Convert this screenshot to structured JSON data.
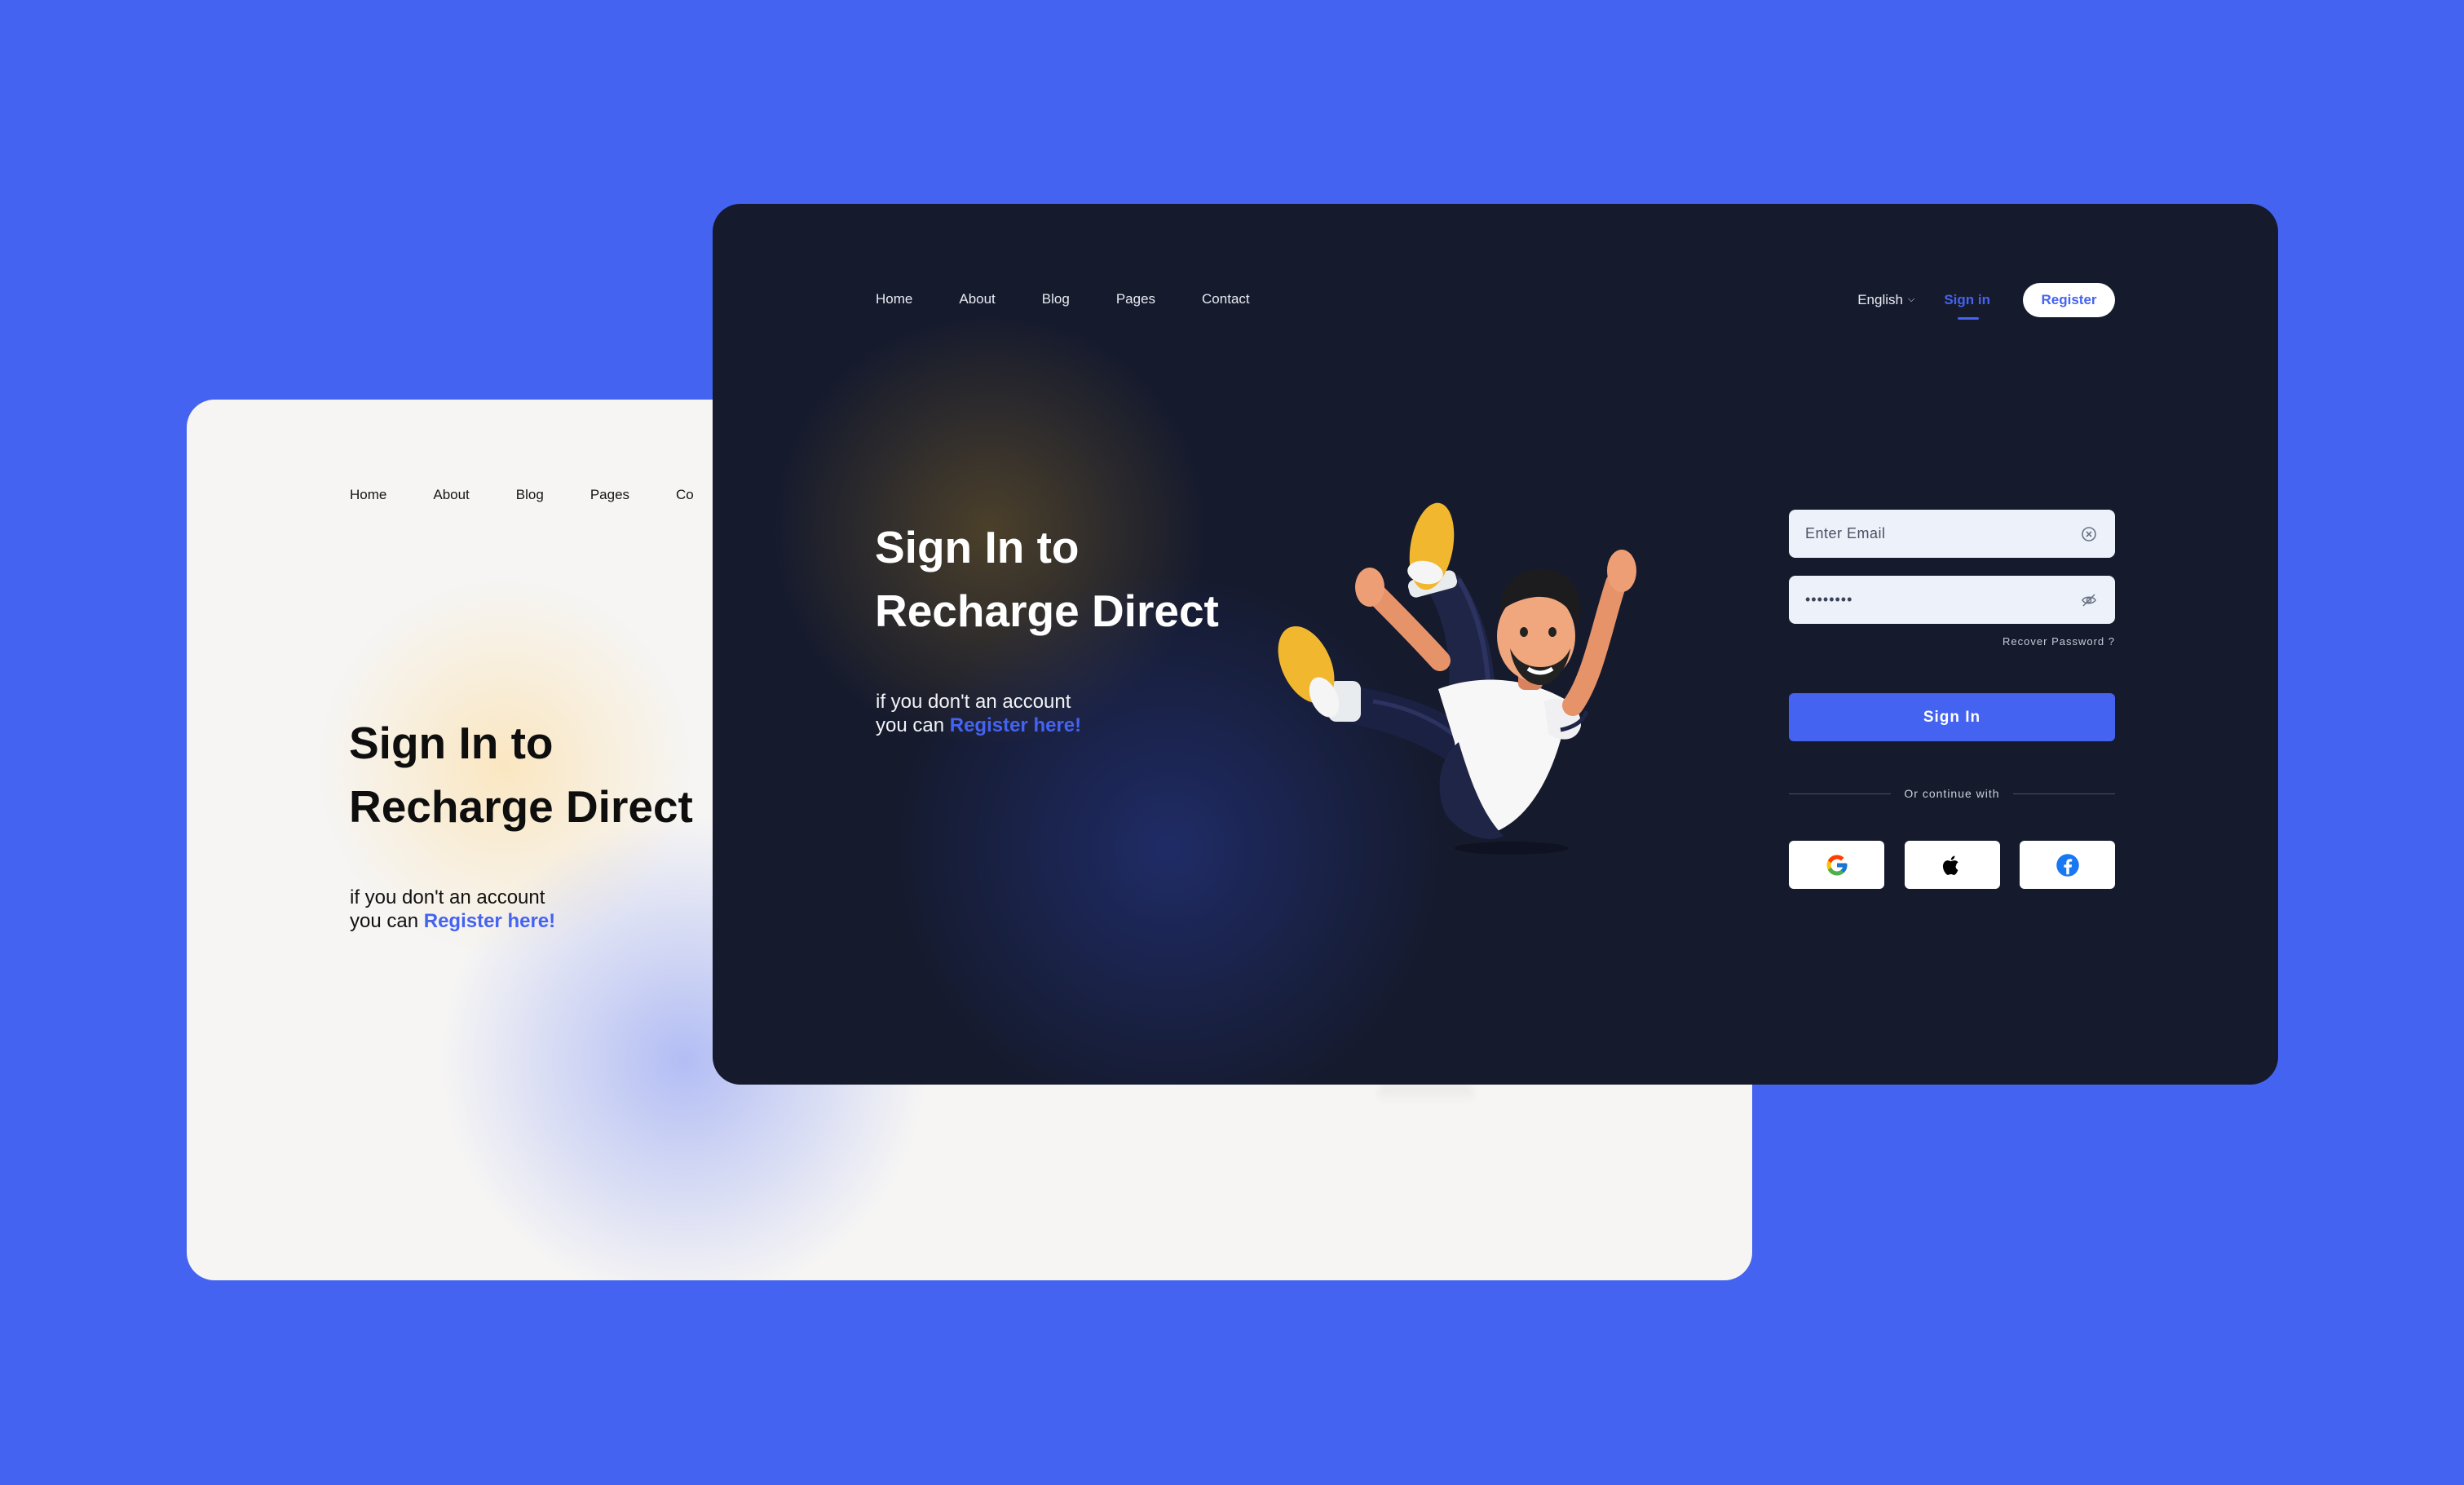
{
  "nav": [
    "Home",
    "About",
    "Blog",
    "Pages",
    "Contact"
  ],
  "light_card": {
    "nav": [
      "Home",
      "About",
      "Blog",
      "Pages",
      "Co"
    ],
    "title_line1": "Sign In to",
    "title_line2": "Recharge Direct",
    "sub_line1": "if you don't an account",
    "sub_line2_prefix": "you can ",
    "register_link": "Register here!"
  },
  "header": {
    "language": "English",
    "signin": "Sign in",
    "register": "Register"
  },
  "hero": {
    "title_line1": "Sign In to",
    "title_line2": "Recharge Direct",
    "sub_line1": "if you don't an account",
    "sub_line2_prefix": "you can ",
    "register_link": "Register here!"
  },
  "form": {
    "email_placeholder": "Enter Email",
    "password_value": "••••••••",
    "recover": "Recover Password ?",
    "signin_button": "Sign In",
    "divider": "Or continue with",
    "socials": [
      "google-icon",
      "apple-icon",
      "facebook-icon"
    ]
  },
  "colors": {
    "background": "#4463F1",
    "dark_card": "#151A2D",
    "light_card": "#F6F5F4",
    "accent": "#4463F1"
  }
}
